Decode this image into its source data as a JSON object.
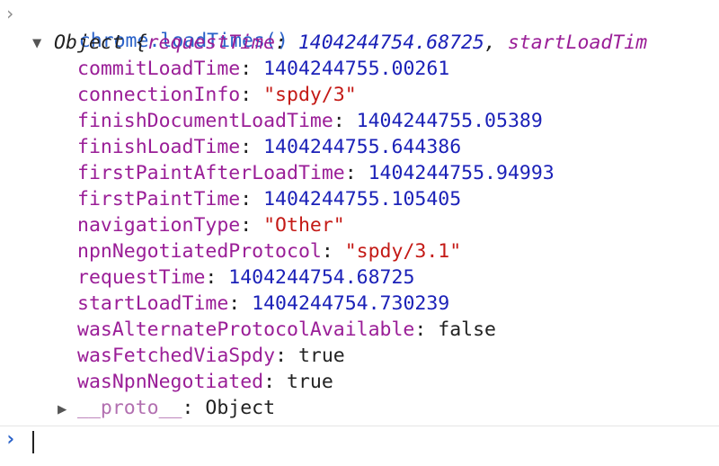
{
  "console": {
    "input_command": "chrome.loadTimes()",
    "object_summary": {
      "label": "Object {",
      "preview_key": "requestTime",
      "preview_value": "1404244754.68725",
      "preview_key2": "startLoadTim"
    },
    "properties": [
      {
        "key": "commitLoadTime",
        "value": "1404244755.00261",
        "type": "number"
      },
      {
        "key": "connectionInfo",
        "value": "\"spdy/3\"",
        "type": "string"
      },
      {
        "key": "finishDocumentLoadTime",
        "value": "1404244755.05389",
        "type": "number"
      },
      {
        "key": "finishLoadTime",
        "value": "1404244755.644386",
        "type": "number"
      },
      {
        "key": "firstPaintAfterLoadTime",
        "value": "1404244755.94993",
        "type": "number"
      },
      {
        "key": "firstPaintTime",
        "value": "1404244755.105405",
        "type": "number"
      },
      {
        "key": "navigationType",
        "value": "\"Other\"",
        "type": "string"
      },
      {
        "key": "npnNegotiatedProtocol",
        "value": "\"spdy/3.1\"",
        "type": "string"
      },
      {
        "key": "requestTime",
        "value": "1404244754.68725",
        "type": "number"
      },
      {
        "key": "startLoadTime",
        "value": "1404244754.730239",
        "type": "number"
      },
      {
        "key": "wasAlternateProtocolAvailable",
        "value": "false",
        "type": "bool"
      },
      {
        "key": "wasFetchedViaSpdy",
        "value": "true",
        "type": "bool"
      },
      {
        "key": "wasNpnNegotiated",
        "value": "true",
        "type": "bool"
      }
    ],
    "proto": {
      "key": "__proto__",
      "value": "Object"
    }
  },
  "colors": {
    "input": "#2a62c9",
    "key": "#9a1e97",
    "number": "#1b21b8",
    "string": "#c41a16"
  },
  "icons": {
    "prompt": "chevron-right-icon",
    "expanded": "triangle-down-icon",
    "collapsed": "triangle-right-icon"
  }
}
